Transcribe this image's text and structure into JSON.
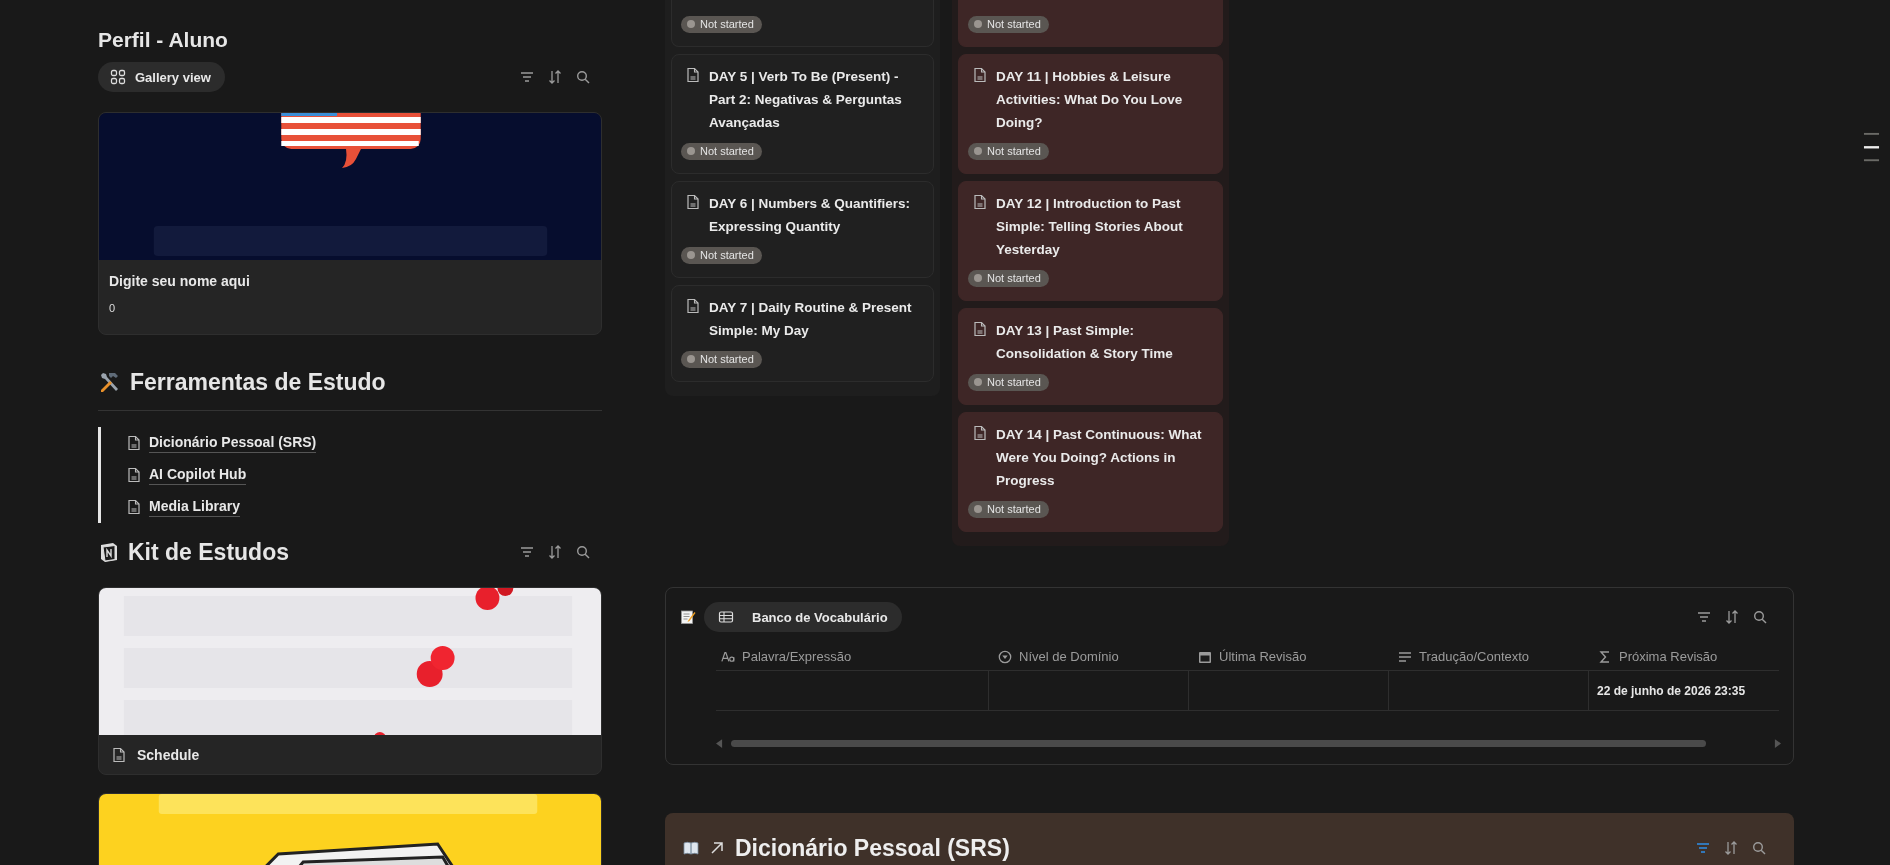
{
  "profile": {
    "title": "Perfil - Aluno",
    "view_label": "Gallery view",
    "card": {
      "kind": "flag",
      "title": "Digite seu nome aqui",
      "value": "0"
    }
  },
  "tools": {
    "title": "Ferramentas de Estudo",
    "links": [
      {
        "label": "Dicionário Pessoal (SRS)"
      },
      {
        "label": "AI Copilot Hub"
      },
      {
        "label": "Media Library"
      }
    ]
  },
  "kit": {
    "title": "Kit de Estudos",
    "cards": [
      {
        "kind": "calendar",
        "title": "Schedule"
      },
      {
        "kind": "flashcards"
      }
    ]
  },
  "board": {
    "columns": [
      {
        "color": "#202020",
        "cards": [
          {
            "status": "Not started"
          },
          {
            "title": "DAY 5 | Verb To Be (Present) - Part 2: Negativas & Perguntas Avançadas",
            "status": "Not started"
          },
          {
            "title": "DAY 6 | Numbers & Quantifiers: Expressing Quantity",
            "status": "Not started"
          },
          {
            "title": "DAY 7 | Daily Routine & Present Simple: My Day",
            "status": "Not started"
          }
        ]
      },
      {
        "color": "#3e2626",
        "cards": [
          {
            "status": "Not started"
          },
          {
            "title": "DAY 11 | Hobbies & Leisure Activities: What Do You Love Doing?",
            "status": "Not started"
          },
          {
            "title": "DAY 12 | Introduction to Past Simple: Telling Stories About Yesterday",
            "status": "Not started"
          },
          {
            "title": "DAY 13 | Past Simple: Consolidation & Story Time",
            "status": "Not started"
          },
          {
            "title": "DAY 14 | Past Continuous: What Were You Doing? Actions in Progress",
            "status": "Not started"
          }
        ]
      }
    ]
  },
  "vocabulary": {
    "view_label": "Banco de Vocabulário",
    "columns": [
      {
        "kind": "title",
        "label": "Palavra/Expressão"
      },
      {
        "kind": "select",
        "label": "Nível de Domínio"
      },
      {
        "kind": "date",
        "label": "Última Revisão"
      },
      {
        "kind": "text",
        "label": "Tradução/Contexto"
      },
      {
        "kind": "formula",
        "label": "Próxima Revisão"
      }
    ],
    "rows": [
      {
        "cells": [
          null,
          null,
          null,
          null,
          "22 de junho de 2026 23:35"
        ]
      }
    ]
  },
  "dictionary": {
    "title": "Dicionário Pessoal (SRS)",
    "linked": true,
    "filter_active": true
  }
}
